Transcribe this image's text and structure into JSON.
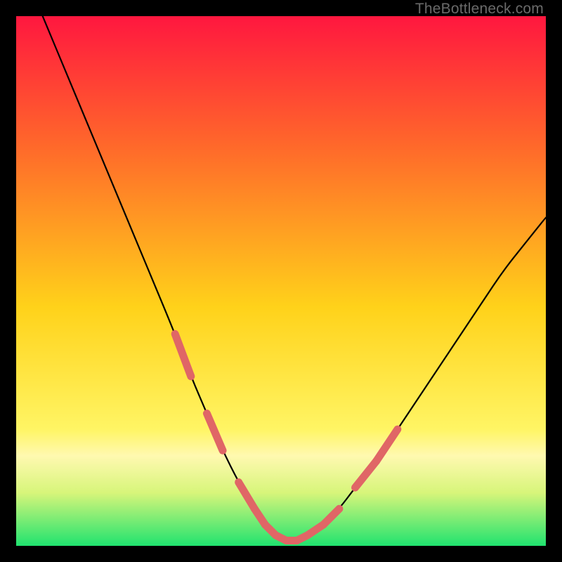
{
  "watermark": "TheBottleneck.com",
  "colors": {
    "bg_black": "#000000",
    "grad_top": "#ff173f",
    "grad_mid1": "#ff6a2a",
    "grad_mid2": "#ffd21a",
    "grad_low": "#fff564",
    "grad_bottom": "#20e36f",
    "curve": "#000000",
    "marker": "#e06666"
  },
  "chart_data": {
    "type": "line",
    "title": "",
    "xlabel": "",
    "ylabel": "",
    "xlim": [
      0,
      100
    ],
    "ylim": [
      0,
      100
    ],
    "grid": false,
    "series": [
      {
        "name": "bottleneck-curve",
        "x": [
          0,
          5,
          10,
          15,
          20,
          25,
          30,
          33,
          36,
          39,
          42,
          45,
          47,
          49,
          51,
          53,
          55,
          58,
          61,
          64,
          68,
          72,
          76,
          80,
          84,
          88,
          92,
          96,
          100
        ],
        "y": [
          112,
          100,
          88,
          76,
          64,
          52,
          40,
          32,
          25,
          18,
          12,
          7,
          4,
          2,
          1,
          1,
          2,
          4,
          7,
          11,
          16,
          22,
          28,
          34,
          40,
          46,
          52,
          57,
          62
        ]
      }
    ],
    "markers": {
      "name": "highlight-segments",
      "segments": [
        {
          "x": [
            30,
            33
          ],
          "y": [
            40,
            32
          ]
        },
        {
          "x": [
            36,
            39
          ],
          "y": [
            25,
            18
          ]
        },
        {
          "x": [
            42,
            45
          ],
          "y": [
            12,
            7
          ]
        },
        {
          "x": [
            45,
            47
          ],
          "y": [
            7,
            4
          ]
        },
        {
          "x": [
            47,
            49
          ],
          "y": [
            4,
            2
          ]
        },
        {
          "x": [
            49,
            51
          ],
          "y": [
            2,
            1
          ]
        },
        {
          "x": [
            51,
            53
          ],
          "y": [
            1,
            1
          ]
        },
        {
          "x": [
            53,
            55
          ],
          "y": [
            1,
            2
          ]
        },
        {
          "x": [
            55,
            58
          ],
          "y": [
            2,
            4
          ]
        },
        {
          "x": [
            58,
            61
          ],
          "y": [
            4,
            7
          ]
        },
        {
          "x": [
            64,
            68
          ],
          "y": [
            11,
            16
          ]
        },
        {
          "x": [
            68,
            72
          ],
          "y": [
            16,
            22
          ]
        }
      ]
    },
    "gradient_stops": [
      {
        "offset": 0.0,
        "color": "#ff173f"
      },
      {
        "offset": 0.25,
        "color": "#ff6a2a"
      },
      {
        "offset": 0.55,
        "color": "#ffd21a"
      },
      {
        "offset": 0.78,
        "color": "#fff564"
      },
      {
        "offset": 0.83,
        "color": "#fff9b0"
      },
      {
        "offset": 0.9,
        "color": "#d7f57a"
      },
      {
        "offset": 1.0,
        "color": "#20e36f"
      }
    ]
  }
}
